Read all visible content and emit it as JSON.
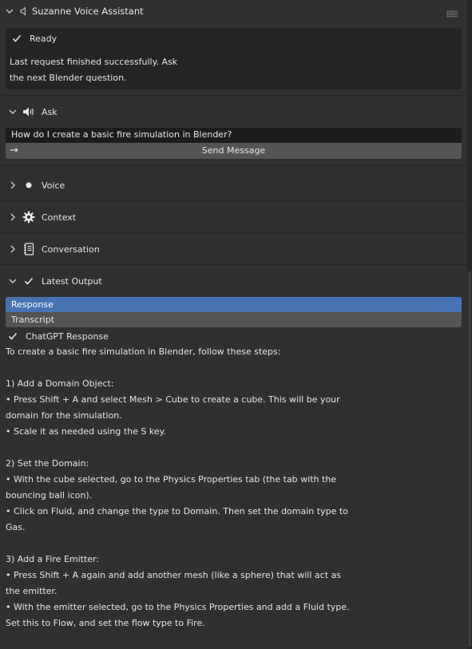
{
  "header": {
    "title": "Suzanne Voice Assistant"
  },
  "status": {
    "label": "Ready",
    "lines": [
      "Last request finished successfully. Ask",
      "the next Blender question."
    ]
  },
  "ask": {
    "title": "Ask",
    "input_value": "How do I create a basic fire simulation in Blender?",
    "send_label": "Send Message"
  },
  "sections": {
    "voice": "Voice",
    "context": "Context",
    "conversation": "Conversation",
    "latest_output": "Latest Output"
  },
  "output": {
    "tabs": [
      "Response",
      "Transcript"
    ],
    "response_header": "ChatGPT Response",
    "lines": [
      "To create a basic fire simulation in Blender, follow these steps:",
      "",
      "1) Add a Domain Object:",
      "• Press Shift + A and select Mesh > Cube to create a cube. This will be your",
      "domain for the simulation.",
      "• Scale it as needed using the S key.",
      "",
      "2) Set the Domain:",
      "• With the cube selected, go to the Physics Properties tab (the tab with the",
      "bouncing ball icon).",
      "• Click on Fluid, and change the type to Domain. Then set the domain type to",
      "Gas.",
      "",
      "3) Add a Fire Emitter:",
      "• Press Shift + A again and add another mesh (like a sphere) that will act as",
      "the emitter.",
      "• With the emitter selected, go to the Physics Properties and add a Fluid type.",
      "Set this to Flow, and set the flow type to Fire."
    ]
  },
  "icons": {
    "collapse": "chevron-down-icon",
    "expand": "chevron-right-icon",
    "speaker": "speaker-icon",
    "check": "check-icon",
    "dot": "dot-icon",
    "gear": "gear-icon",
    "book": "book-icon",
    "arrow": "arrow-right-icon",
    "grip": "grip-icon"
  },
  "colors": {
    "accent": "#4772b3",
    "panel_bg": "#303030",
    "field_bg": "#1d1d1d",
    "button_bg": "#545454"
  }
}
